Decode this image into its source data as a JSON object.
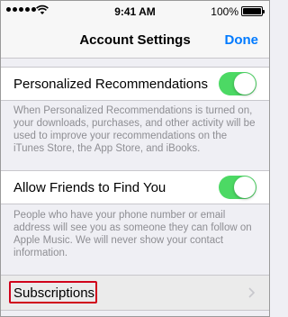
{
  "status_bar": {
    "time": "9:41 AM",
    "battery_percent": "100%",
    "battery_level": 1.0,
    "icons": [
      "signal-icon",
      "wifi-icon",
      "battery-icon"
    ]
  },
  "nav": {
    "title": "Account Settings",
    "done_label": "Done"
  },
  "personalized": {
    "label": "Personalized Recommendations",
    "toggle_on": true,
    "footer": "When Personalized Recommendations is turned on, your downloads, purchases, and other activity will be used to improve your recommendations on the iTunes Store, the App Store, and iBooks."
  },
  "friends": {
    "label": "Allow Friends to Find You",
    "toggle_on": true,
    "footer": "People who have your phone number or email address will see you as someone they can follow on Apple Music. We will never show your contact information."
  },
  "subscriptions": {
    "label": "Subscriptions"
  },
  "colors": {
    "accent": "#007aff",
    "toggle_on": "#4cd964",
    "highlight": "#d0021b",
    "background": "#efeff4"
  }
}
